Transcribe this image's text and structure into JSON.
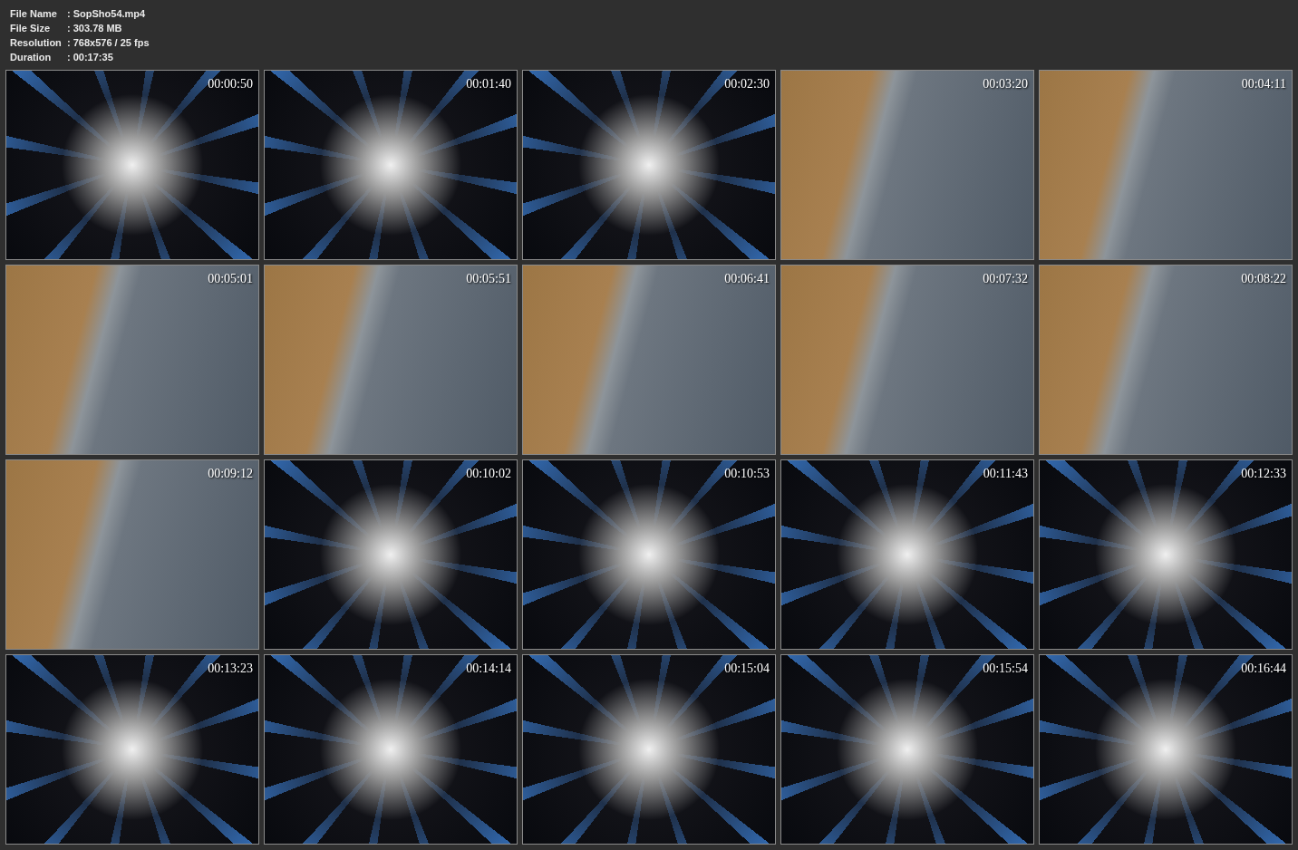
{
  "info": [
    {
      "label": "File Name",
      "value": ": SopSho54.mp4"
    },
    {
      "label": "File Size",
      "value": ": 303.78 MB"
    },
    {
      "label": "Resolution",
      "value": ": 768x576 / 25 fps"
    },
    {
      "label": "Duration",
      "value": ": 00:17:35"
    }
  ],
  "frames": [
    {
      "kind": "burst",
      "time": "00:00:50"
    },
    {
      "kind": "burst",
      "time": "00:01:40"
    },
    {
      "kind": "burst",
      "time": "00:02:30"
    },
    {
      "kind": "shore",
      "time": "00:03:20"
    },
    {
      "kind": "shore",
      "time": "00:04:11"
    },
    {
      "kind": "shore",
      "time": "00:05:01"
    },
    {
      "kind": "shore",
      "time": "00:05:51"
    },
    {
      "kind": "shore",
      "time": "00:06:41"
    },
    {
      "kind": "shore",
      "time": "00:07:32"
    },
    {
      "kind": "shore",
      "time": "00:08:22"
    },
    {
      "kind": "shore",
      "time": "00:09:12"
    },
    {
      "kind": "burst",
      "time": "00:10:02"
    },
    {
      "kind": "burst",
      "time": "00:10:53"
    },
    {
      "kind": "burst",
      "time": "00:11:43"
    },
    {
      "kind": "burst",
      "time": "00:12:33"
    },
    {
      "kind": "burst",
      "time": "00:13:23"
    },
    {
      "kind": "burst",
      "time": "00:14:14"
    },
    {
      "kind": "burst",
      "time": "00:15:04"
    },
    {
      "kind": "burst",
      "time": "00:15:54"
    },
    {
      "kind": "burst",
      "time": "00:16:44"
    }
  ]
}
